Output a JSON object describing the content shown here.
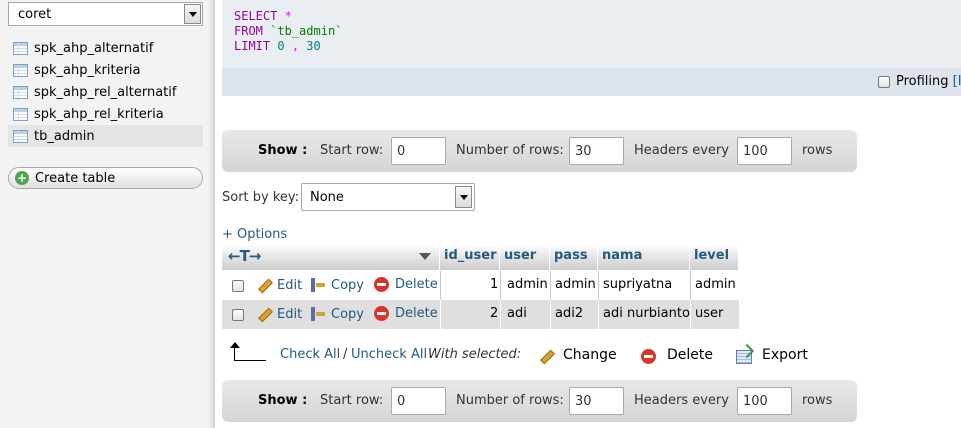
{
  "sidebar": {
    "database_select": "coret",
    "tables": [
      {
        "name": "spk_ahp_alternatif",
        "active": false
      },
      {
        "name": "spk_ahp_kriteria",
        "active": false
      },
      {
        "name": "spk_ahp_rel_alternatif",
        "active": false
      },
      {
        "name": "spk_ahp_rel_kriteria",
        "active": false
      },
      {
        "name": "tb_admin",
        "active": true
      }
    ],
    "create_table_label": "Create table"
  },
  "sql": {
    "line1_kw": "SELECT",
    "line1_star": "*",
    "line2_kw": "FROM",
    "line2_table": "`tb_admin`",
    "line3_kw": "LIMIT",
    "line3_offset": "0",
    "line3_comma": ",",
    "line3_count": "30",
    "profiling_label": "Profiling",
    "profiling_link": "[I"
  },
  "nav_top": {
    "show": "Show :",
    "start_row_label": "Start row:",
    "start_row_value": "0",
    "num_rows_label": "Number of rows:",
    "num_rows_value": "30",
    "headers_every_label": "Headers every",
    "headers_every_value": "100",
    "rows_label": "rows"
  },
  "nav_bottom": {
    "show": "Show :",
    "start_row_label": "Start row:",
    "start_row_value": "0",
    "num_rows_label": "Number of rows:",
    "num_rows_value": "30",
    "headers_every_label": "Headers every",
    "headers_every_value": "100",
    "rows_label": "rows"
  },
  "sort": {
    "label": "Sort by key:",
    "value": "None"
  },
  "options_link": "+ Options",
  "table": {
    "columns": [
      "id_user",
      "user",
      "pass",
      "nama",
      "level"
    ],
    "action_labels": {
      "edit": "Edit",
      "copy": "Copy",
      "delete": "Delete"
    },
    "rows": [
      {
        "id_user": "1",
        "user": "admin",
        "pass": "admin",
        "nama": "supriyatna",
        "level": "admin"
      },
      {
        "id_user": "2",
        "user": "adi",
        "pass": "adi2",
        "nama": "adi nurbianto",
        "level": "user"
      }
    ]
  },
  "with_selected": {
    "check_all": "Check All",
    "separator": "/",
    "uncheck_all": "Uncheck All",
    "label": "With selected:",
    "change": "Change",
    "delete": "Delete",
    "export": "Export"
  }
}
